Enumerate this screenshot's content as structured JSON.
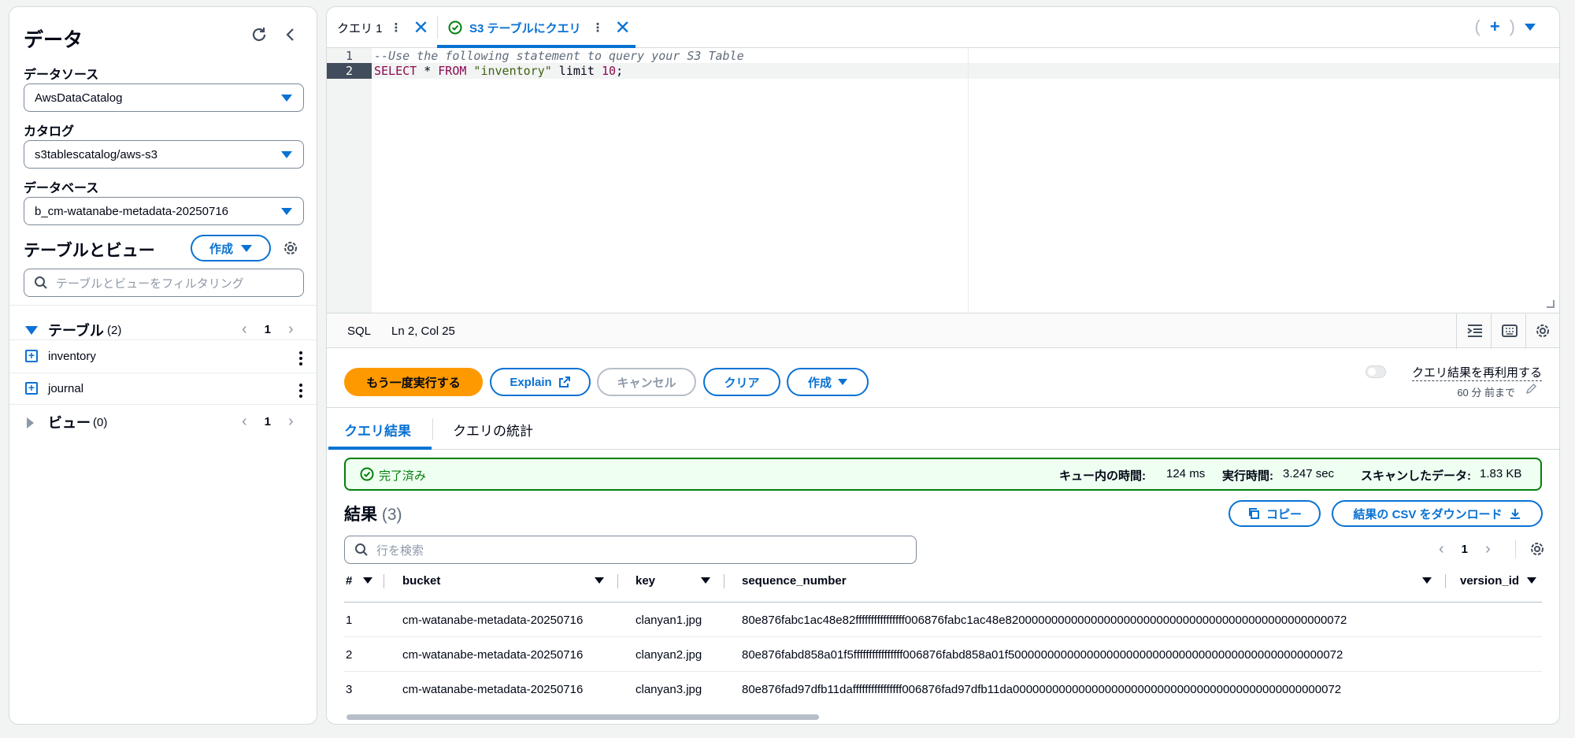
{
  "left": {
    "title": "データ",
    "data_source_label": "データソース",
    "data_source_value": "AwsDataCatalog",
    "catalog_label": "カタログ",
    "catalog_value": "s3tablescatalog/aws-s3",
    "database_label": "データベース",
    "database_value": "b_cm-watanabe-metadata-20250716",
    "tables_views_title": "テーブルとビュー",
    "create_label": "作成",
    "filter_placeholder": "テーブルとビューをフィルタリング",
    "tables_label": "テーブル",
    "tables_count": "(2)",
    "tables_page": "1",
    "tables": [
      "inventory",
      "journal"
    ],
    "views_label": "ビュー",
    "views_count": "(0)",
    "views_page": "1"
  },
  "tabs": {
    "tab1": "クエリ 1",
    "tab2": "S3 テーブルにクエリ"
  },
  "editor": {
    "lines": [
      {
        "num": "1",
        "text": "--Use the following statement to query your S3 Table"
      },
      {
        "num": "2",
        "kw1": "SELECT",
        "mid": " * ",
        "kw2": "FROM",
        "str": " \"inventory\"",
        "rest": " limit ",
        "num_val": "10",
        "end": ";"
      }
    ],
    "language": "SQL",
    "cursor": "Ln 2, Col 25"
  },
  "actions": {
    "run_again": "もう一度実行する",
    "explain": "Explain",
    "cancel": "キャンセル",
    "clear": "クリア",
    "create": "作成",
    "reuse_label": "クエリ結果を再利用する",
    "reuse_sub": "60 分 前まで"
  },
  "result_tabs": {
    "results": "クエリ結果",
    "stats": "クエリの統計"
  },
  "status": {
    "state": "完了済み",
    "queue_label": "キュー内の時間:",
    "queue_value": "124 ms",
    "exec_label": "実行時間:",
    "exec_value": "3.247 sec",
    "scan_label": "スキャンしたデータ:",
    "scan_value": "1.83 KB"
  },
  "results": {
    "title": "結果",
    "count": "(3)",
    "copy": "コピー",
    "download": "結果の CSV をダウンロード",
    "search_placeholder": "行を検索",
    "page": "1",
    "columns": [
      "#",
      "bucket",
      "key",
      "sequence_number",
      "version_id"
    ],
    "rows": [
      [
        "1",
        "cm-watanabe-metadata-20250716",
        "clanyan1.jpg",
        "80e876fabc1ac48e82ffffffffffffffff006876fabc1ac48e8200000000000000000000000000000000000000000000000072"
      ],
      [
        "2",
        "cm-watanabe-metadata-20250716",
        "clanyan2.jpg",
        "80e876fabd858a01f5ffffffffffffffff006876fabd858a01f500000000000000000000000000000000000000000000000072"
      ],
      [
        "3",
        "cm-watanabe-metadata-20250716",
        "clanyan3.jpg",
        "80e876fad97dfb11daffffffffffffffff006876fad97dfb11da00000000000000000000000000000000000000000000000072"
      ]
    ]
  },
  "colors": {
    "accent": "#0972d3",
    "primary_button": "#ff9900",
    "success": "#037f0c"
  }
}
